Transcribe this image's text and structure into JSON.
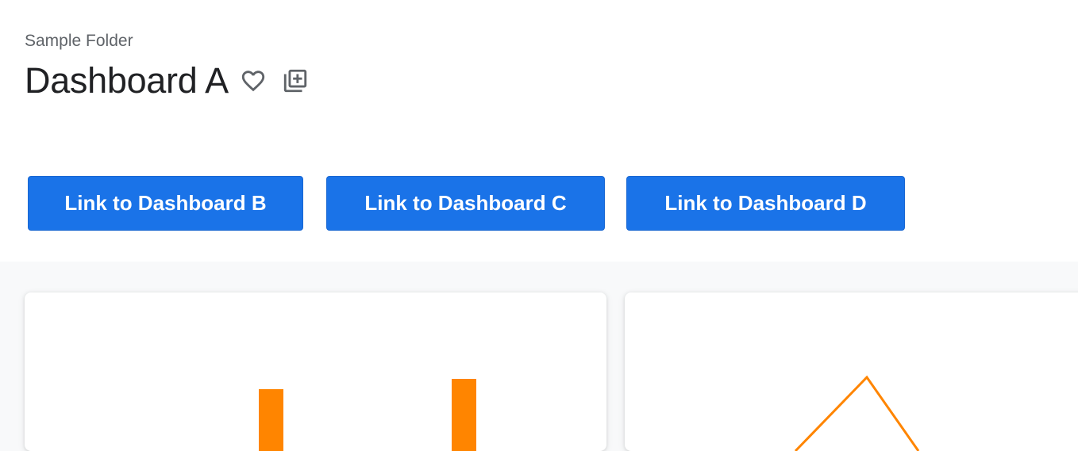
{
  "header": {
    "folder": "Sample Folder",
    "title": "Dashboard A",
    "favorite_icon": "heart-outline-icon",
    "duplicate_icon": "library-add-icon"
  },
  "links": [
    {
      "label": "Link to Dashboard B"
    },
    {
      "label": "Link to Dashboard C"
    },
    {
      "label": "Link to Dashboard D"
    }
  ],
  "colors": {
    "accent": "#1a73e8",
    "series": "#ff8500",
    "title": "#202124",
    "subtle": "#5f6368"
  },
  "tiles": [
    {
      "chart_type": "bar"
    },
    {
      "chart_type": "line"
    }
  ]
}
